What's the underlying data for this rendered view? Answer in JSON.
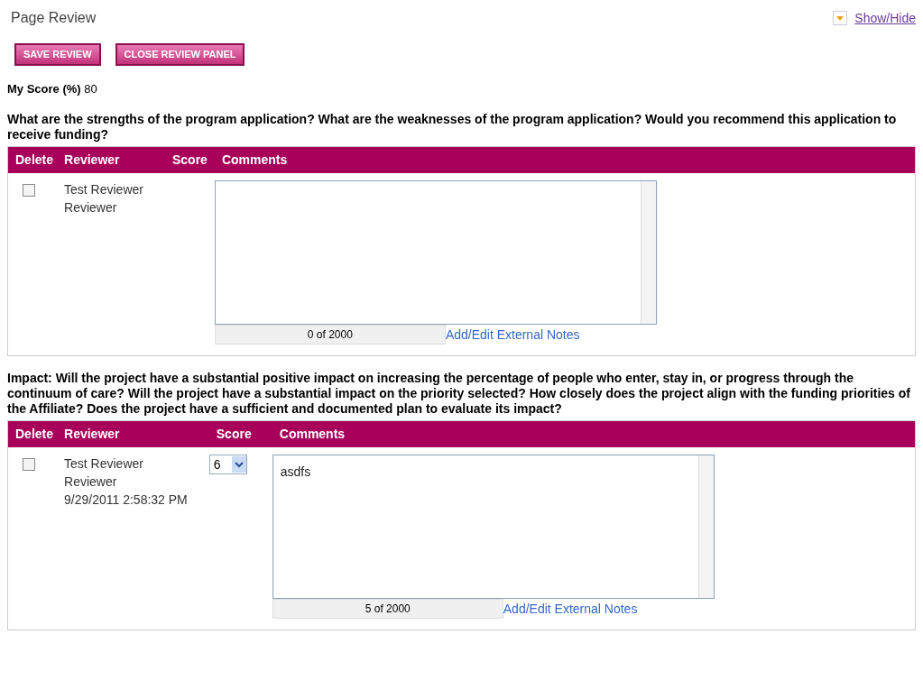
{
  "title": "Page Review",
  "show_hide": "Show/Hide",
  "buttons": [
    "SAVE REVIEW",
    "CLOSE REVIEW PANEL"
  ],
  "my_score": {
    "label": "My Score (%)",
    "value": "80"
  },
  "sections": [
    {
      "question": "What are the strengths of the program application? What are the weaknesses of the program application? Would you recommend this application to receive funding?",
      "columns": [
        "Delete",
        "Reviewer",
        "Score",
        "Comments"
      ],
      "rows": [
        {
          "checked": false,
          "reviewer": [
            "Test Reviewer",
            "Reviewer"
          ],
          "counter": "0 of 2000",
          "notes_link": "Add/Edit External Notes"
        }
      ]
    },
    {
      "question": "Impact: Will the project have a substantial positive impact on increasing the percentage of people who enter, stay in, or progress through the continuum of care? Will the project have a substantial impact on the priority selected? How closely does the project align with the funding priorities of the Affiliate? Does the project have a sufficient and documented plan to evaluate its impact?",
      "columns": [
        "Delete",
        "Reviewer",
        "Score",
        "Comments"
      ],
      "rows": [
        {
          "checked": false,
          "reviewer": [
            "Test Reviewer",
            "Reviewer",
            "9/29/2011 2:58:32 PM"
          ],
          "score": "6",
          "comment": "asdfs",
          "counter": "5 of 2000",
          "notes_link": "Add/Edit External Notes"
        }
      ]
    }
  ]
}
